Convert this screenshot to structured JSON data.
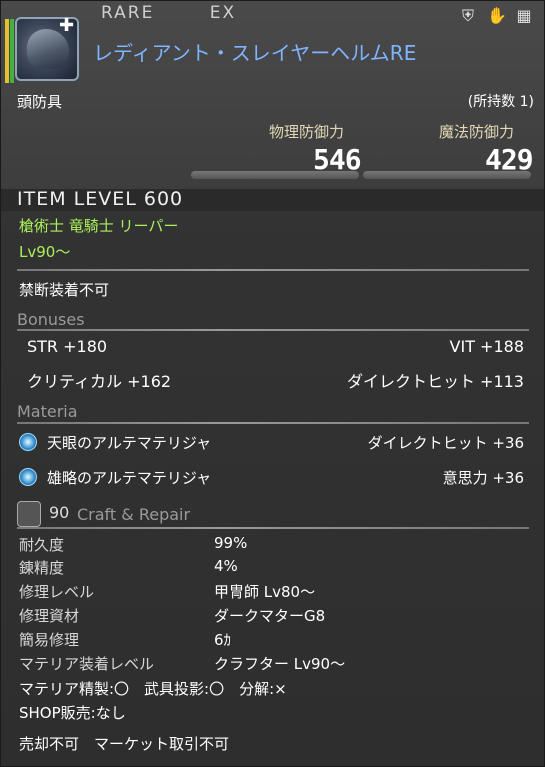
{
  "header": {
    "rarity_tags": [
      "RARE",
      "EX"
    ],
    "item_name": "レディアント・スレイヤーヘルムRE",
    "category": "頭防具",
    "owned": "(所持数 1)",
    "top_icons": [
      "plus-shield-icon",
      "hand-icon",
      "lock-icon"
    ],
    "durability_bar_colors": [
      "#e0c232",
      "#46b03c"
    ]
  },
  "stats": {
    "physical_label": "物理防御力",
    "physical_value": "546",
    "magic_label": "魔法防御力",
    "magic_value": "429"
  },
  "item_level": "ITEM LEVEL 600",
  "jobs": "槍術士 竜騎士 リーパー",
  "level_req": "Lv90～",
  "restriction": "禁断装着不可",
  "bonuses": {
    "title": "Bonuses",
    "rows": [
      {
        "left": "STR +180",
        "right": "VIT +188"
      },
      {
        "left": "クリティカル +162",
        "right": "ダイレクトヒット +113"
      }
    ]
  },
  "materia": {
    "title": "Materia",
    "slots": [
      {
        "name": "天眼のアルテマテリジャ",
        "effect": "ダイレクトヒット +36"
      },
      {
        "name": "雄略のアルテマテリジャ",
        "effect": "意思力 +36"
      }
    ]
  },
  "craft": {
    "level": "90",
    "title": "Craft & Repair",
    "rows": [
      {
        "key": "耐久度",
        "value": "99%"
      },
      {
        "key": "錬精度",
        "value": "4%"
      },
      {
        "key": "修理レベル",
        "value": "甲冑師 Lv80～"
      },
      {
        "key": "修理資材",
        "value": "ダークマターG8"
      },
      {
        "key": "簡易修理",
        "value": "6ｶ"
      },
      {
        "key": "マテリア装着レベル",
        "value": "クラフター Lv90～"
      }
    ],
    "flags": "マテリア精製:〇　武具投影:〇　分解:×",
    "shop": "SHOP販売:なし",
    "trade": "売却不可　マーケット取引不可"
  },
  "colors": {
    "item_name": "#7fb4ff",
    "job_text": "#aaf05a",
    "section_heading": "#9a9a9a"
  }
}
